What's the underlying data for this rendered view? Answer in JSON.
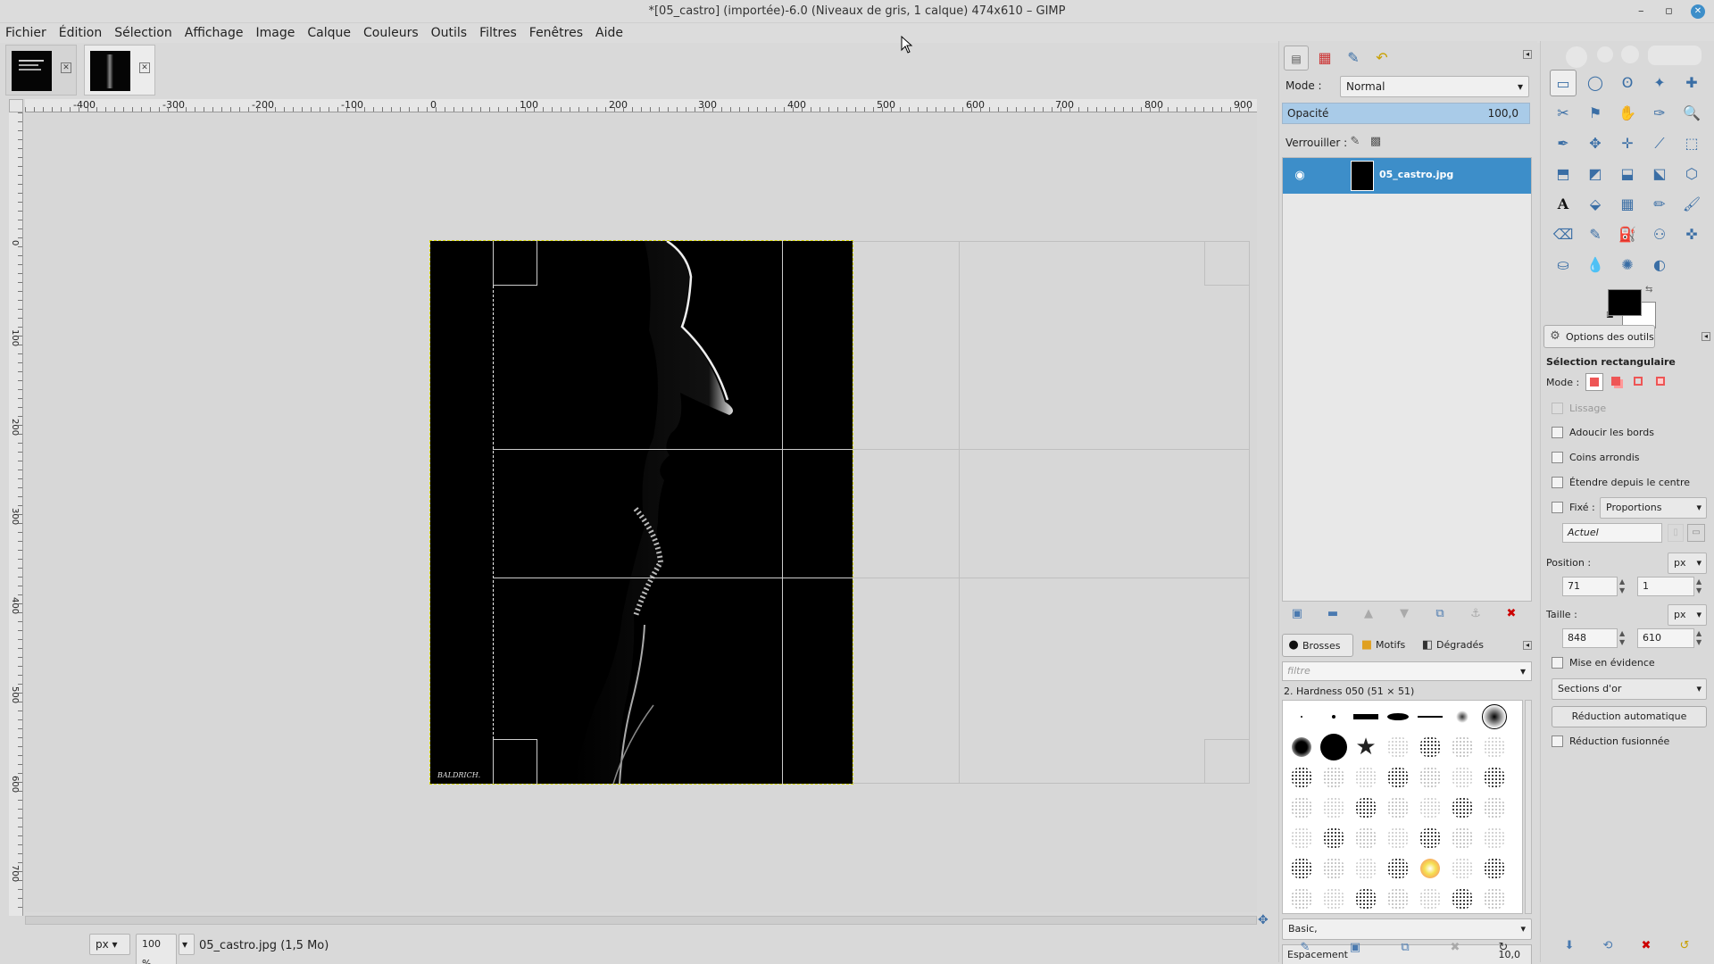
{
  "window": {
    "title": "*[05_castro] (importée)-6.0 (Niveaux de gris, 1 calque) 474x610 – GIMP",
    "minimize": "–",
    "maximize": "▫",
    "close": "✕"
  },
  "menu": [
    "Fichier",
    "Édition",
    "Sélection",
    "Affichage",
    "Image",
    "Calque",
    "Couleurs",
    "Outils",
    "Filtres",
    "Fenêtres",
    "Aide"
  ],
  "image_tabs": [
    {
      "name": "thumb-1",
      "close": "✕"
    },
    {
      "name": "05_castro",
      "close": "✕"
    }
  ],
  "ruler": {
    "top_labels": [
      "-400",
      "-300",
      "-200",
      "-100",
      "0",
      "100",
      "200",
      "300",
      "400",
      "500",
      "600",
      "700",
      "800",
      "900"
    ],
    "left_labels": [
      "0",
      "100",
      "200",
      "300",
      "400",
      "500",
      "600",
      "700"
    ]
  },
  "image": {
    "watermark": "BALDRICH."
  },
  "statusbar": {
    "unit": "px",
    "zoom": "100 %",
    "file_info": "05_castro.jpg (1,5 Mo)"
  },
  "layers_panel": {
    "mode_label": "Mode :",
    "mode_value": "Normal",
    "opacity_label": "Opacité",
    "opacity_value": "100,0",
    "lock_label": "Verrouiller :",
    "layers": [
      {
        "name": "05_castro.jpg",
        "visible": true
      }
    ]
  },
  "brushes_panel": {
    "tabs": [
      "Brosses",
      "Motifs",
      "Dégradés"
    ],
    "filter_placeholder": "filtre",
    "selected_brush": "2. Hardness 050 (51 × 51)",
    "preset": "Basic,",
    "spacing_label": "Espacement",
    "spacing_value": "10,0"
  },
  "tool_options": {
    "tab_title": "Options des outils",
    "tool_name": "Sélection rectangulaire",
    "mode_label": "Mode :",
    "lissage": "Lissage",
    "adoucir": "Adoucir les bords",
    "coins": "Coins arrondis",
    "etendre": "Étendre depuis le centre",
    "fixe_label": "Fixé :",
    "fixe_value": "Proportions",
    "actuel": "Actuel",
    "position_label": "Position :",
    "position_unit": "px",
    "position_x": "71",
    "position_y": "1",
    "taille_label": "Taille :",
    "taille_unit": "px",
    "taille_w": "848",
    "taille_h": "610",
    "mise_en_evidence": "Mise en évidence",
    "guides": "Sections d'or",
    "reduction_auto": "Réduction automatique",
    "reduction_fusion": "Réduction fusionnée"
  },
  "colors": {
    "foreground": "#000000",
    "background": "#ffffff",
    "selection": "#3d8ec9"
  }
}
